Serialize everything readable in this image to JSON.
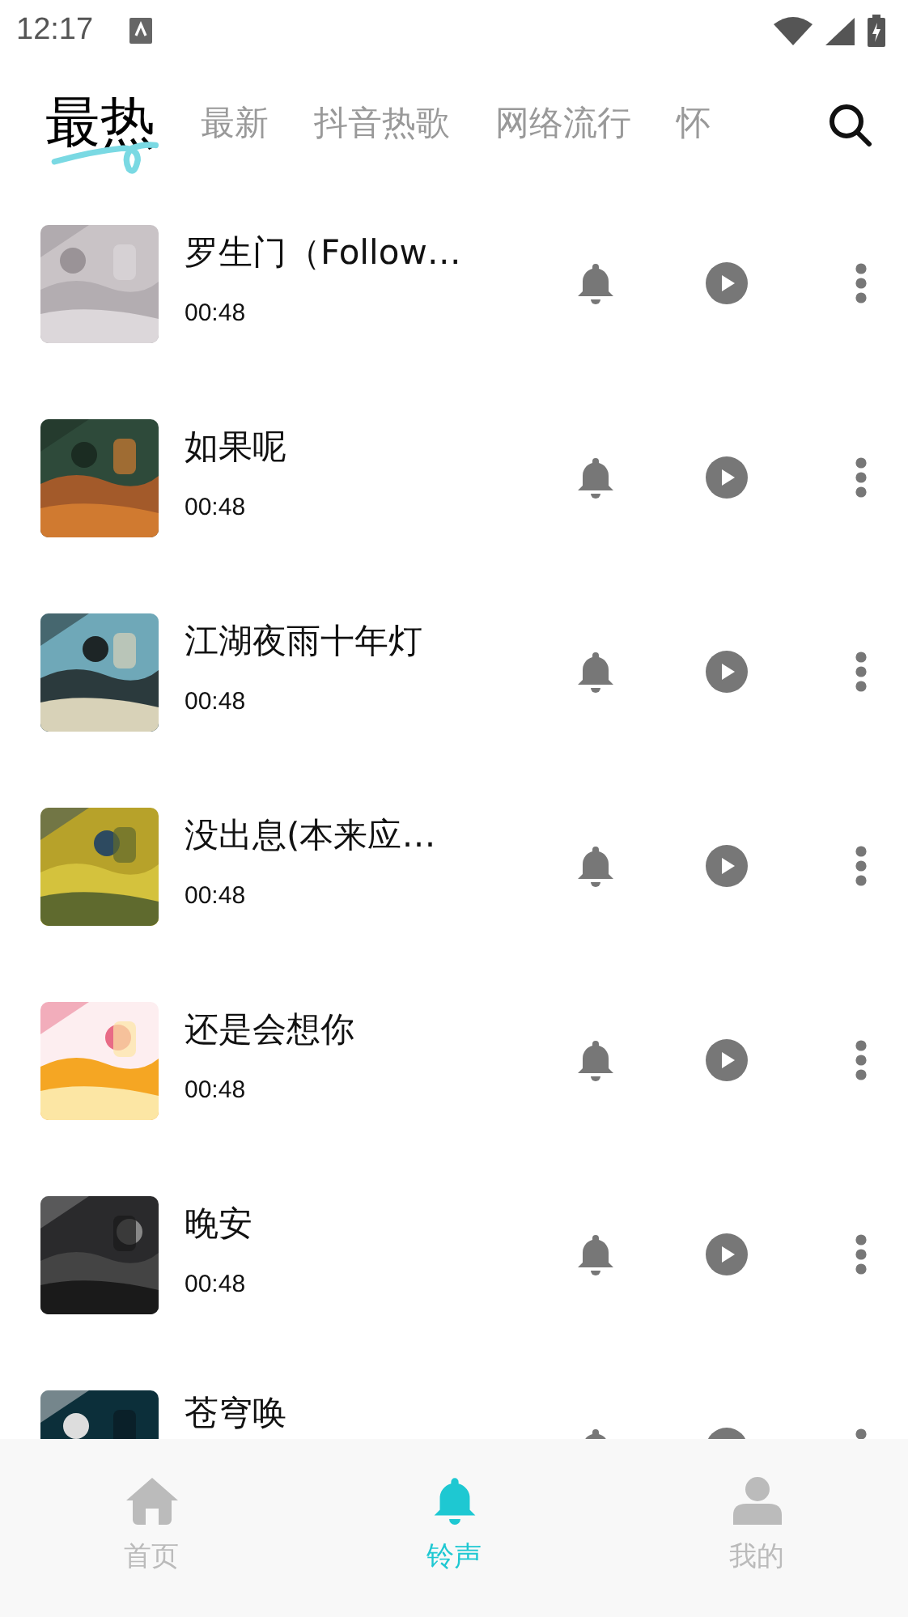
{
  "status_bar": {
    "time": "12:17"
  },
  "tabs": [
    {
      "label": "最热",
      "selected": true
    },
    {
      "label": "最新",
      "selected": false
    },
    {
      "label": "抖音热歌",
      "selected": false
    },
    {
      "label": "网络流行",
      "selected": false
    },
    {
      "label": "怀",
      "selected": false
    }
  ],
  "songs": [
    {
      "title": "罗生门（Follow…",
      "duration": "00:48"
    },
    {
      "title": "如果呢",
      "duration": "00:48"
    },
    {
      "title": "江湖夜雨十年灯",
      "duration": "00:48"
    },
    {
      "title": "没出息(本来应…",
      "duration": "00:48"
    },
    {
      "title": "还是会想你",
      "duration": "00:48"
    },
    {
      "title": "晚安",
      "duration": "00:48"
    },
    {
      "title": "苍穹唤"
    }
  ],
  "bottom_nav": [
    {
      "label": "首页",
      "kind": "home",
      "selected": false
    },
    {
      "label": "铃声",
      "kind": "bell",
      "selected": true
    },
    {
      "label": "我的",
      "kind": "person",
      "selected": false
    }
  ]
}
